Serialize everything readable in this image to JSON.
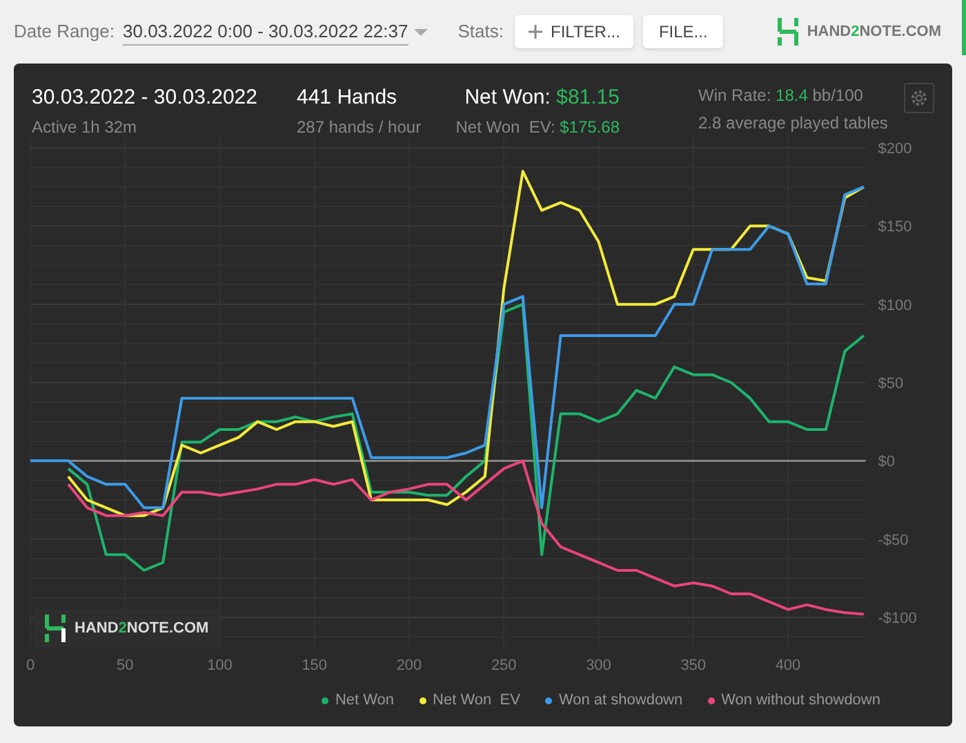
{
  "toolbar": {
    "date_range_label": "Date Range:",
    "date_range": "30.03.2022 0:00 - 30.03.2022 22:37",
    "stats_label": "Stats:",
    "filter_button": "FILTER...",
    "file_button": "FILE...",
    "logo": {
      "prefix": "HAND",
      "digit": "2",
      "suffix": "NOTE.COM"
    }
  },
  "summary": {
    "date_span": "30.03.2022 - 30.03.2022",
    "active": "Active 1h 32m",
    "hands": "441 Hands",
    "hands_rate": "287 hands / hour",
    "net_won_label": "Net Won:",
    "net_won": "$81.15",
    "net_won_ev_label": "Net Won  EV:",
    "net_won_ev": "$175.68",
    "win_rate_label": "Win Rate:",
    "win_rate": "18.4",
    "win_rate_unit": "bb/100",
    "tables": "2.8 average played tables"
  },
  "chart_logo": {
    "prefix": "HAND",
    "digit": "2",
    "suffix": "NOTE.COM"
  },
  "chart_data": {
    "type": "line",
    "grid": true,
    "x": [
      0,
      10,
      20,
      30,
      40,
      50,
      60,
      70,
      80,
      90,
      100,
      110,
      120,
      130,
      140,
      150,
      160,
      170,
      180,
      190,
      200,
      210,
      220,
      230,
      240,
      250,
      260,
      270,
      280,
      290,
      300,
      310,
      320,
      330,
      340,
      350,
      360,
      370,
      380,
      390,
      400,
      410,
      420,
      430,
      440
    ],
    "xlim": [
      0,
      441
    ],
    "ylim": [
      -100,
      200
    ],
    "xticks": [
      0,
      50,
      100,
      150,
      200,
      250,
      300,
      350,
      400
    ],
    "yticks": [
      {
        "value": 200,
        "label": "$200"
      },
      {
        "value": 150,
        "label": "$150"
      },
      {
        "value": 100,
        "label": "$100"
      },
      {
        "value": 50,
        "label": "$50"
      },
      {
        "value": 0,
        "label": "$0"
      },
      {
        "value": -50,
        "label": "-$50"
      },
      {
        "value": -100,
        "label": "-$100"
      }
    ],
    "series": [
      {
        "name": "Net Won",
        "color": "#1db36b",
        "values": [
          null,
          null,
          -5,
          -15,
          -60,
          -60,
          -70,
          -65,
          12,
          12,
          20,
          20,
          25,
          25,
          28,
          25,
          28,
          30,
          -20,
          -20,
          -20,
          -22,
          -22,
          -10,
          0,
          95,
          100,
          -60,
          30,
          30,
          25,
          30,
          45,
          40,
          60,
          55,
          55,
          50,
          40,
          25,
          25,
          20,
          20,
          70,
          80
        ]
      },
      {
        "name": "Net Won  EV",
        "color": "#f2ea3a",
        "values": [
          null,
          null,
          -10,
          -25,
          -30,
          -35,
          -35,
          -30,
          10,
          5,
          10,
          15,
          25,
          20,
          25,
          25,
          22,
          25,
          -25,
          -25,
          -25,
          -25,
          -28,
          -20,
          -10,
          110,
          185,
          160,
          165,
          160,
          140,
          100,
          100,
          100,
          105,
          135,
          135,
          135,
          150,
          150,
          145,
          117,
          115,
          168,
          175
        ]
      },
      {
        "name": "Won at showdown",
        "color": "#3d9be9",
        "values": [
          0,
          0,
          0,
          -10,
          -15,
          -15,
          -30,
          -30,
          40,
          40,
          40,
          40,
          40,
          40,
          40,
          40,
          40,
          40,
          2,
          2,
          2,
          2,
          2,
          5,
          10,
          100,
          105,
          -30,
          80,
          80,
          80,
          80,
          80,
          80,
          100,
          100,
          135,
          135,
          135,
          150,
          145,
          113,
          113,
          170,
          175
        ]
      },
      {
        "name": "Won without showdown",
        "color": "#e8457a",
        "values": [
          null,
          null,
          -15,
          -30,
          -35,
          -35,
          -33,
          -35,
          -20,
          -20,
          -22,
          -20,
          -18,
          -15,
          -15,
          -12,
          -15,
          -12,
          -25,
          -20,
          -18,
          -15,
          -15,
          -25,
          -15,
          -5,
          0,
          -40,
          -55,
          -60,
          -65,
          -70,
          -70,
          -75,
          -80,
          -78,
          -80,
          -85,
          -85,
          -90,
          -95,
          -92,
          -95,
          -97,
          -98
        ]
      }
    ]
  }
}
